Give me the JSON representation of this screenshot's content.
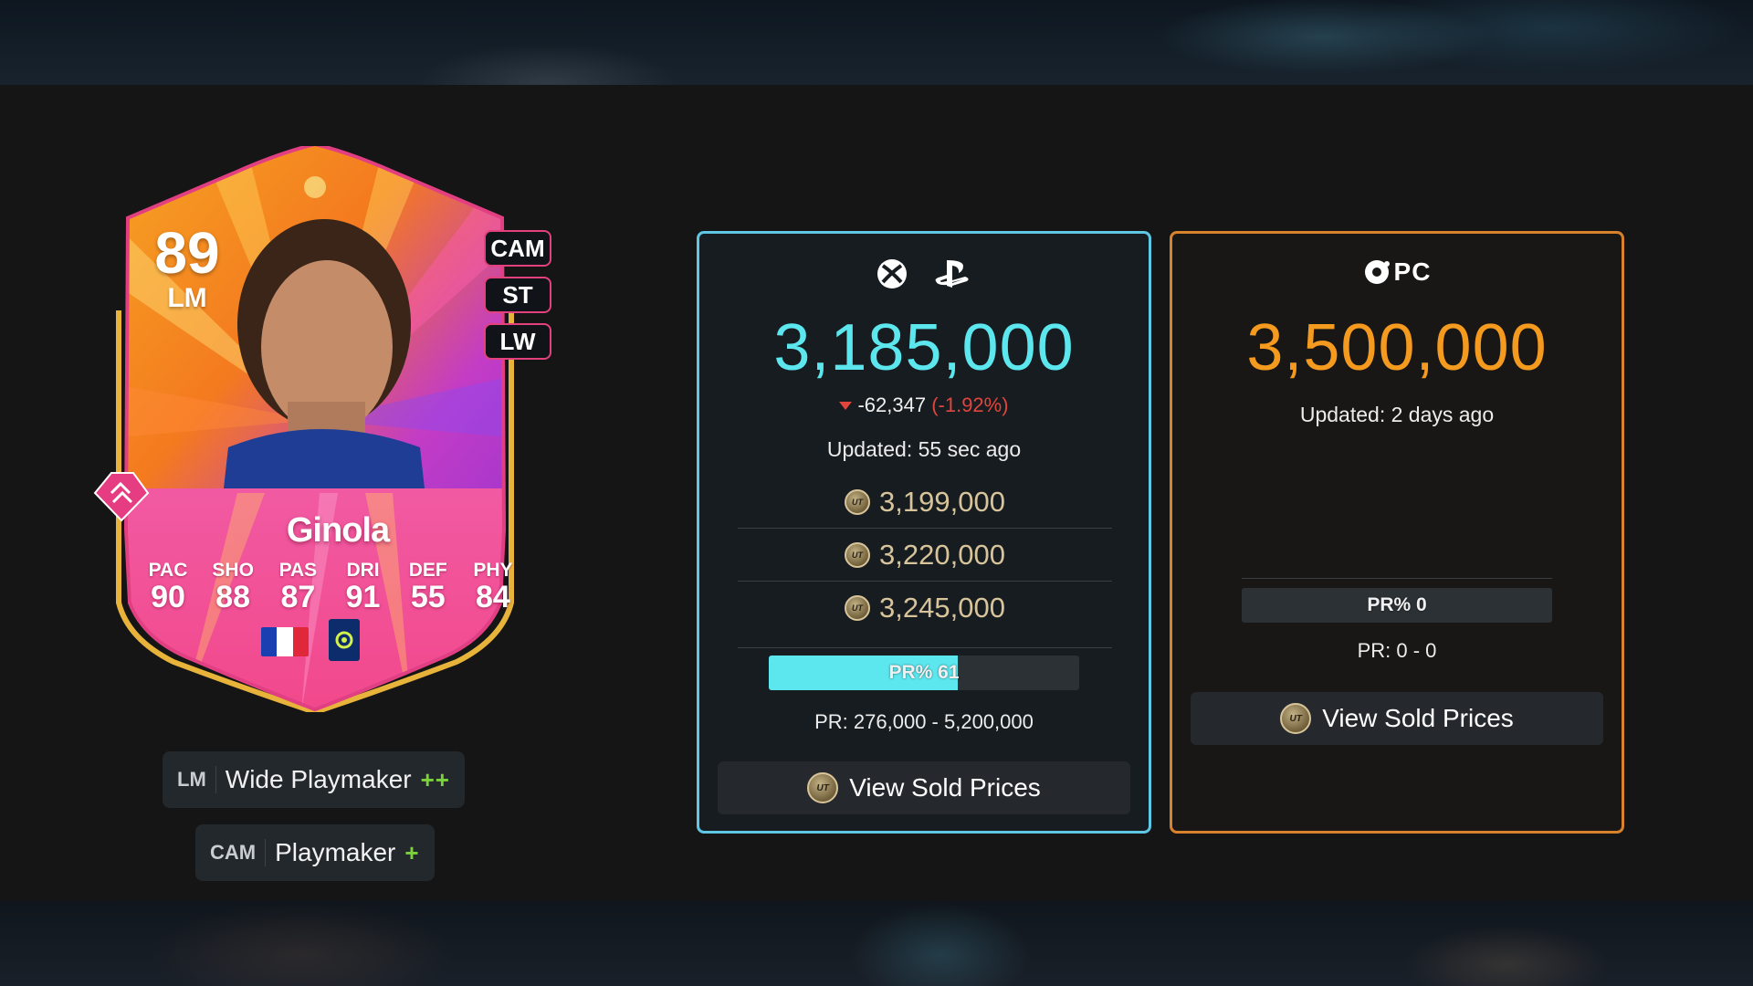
{
  "player": {
    "rating": "89",
    "position": "LM",
    "name": "Ginola",
    "alt_positions": [
      "CAM",
      "ST",
      "LW"
    ],
    "stats": [
      {
        "label": "PAC",
        "value": "90"
      },
      {
        "label": "SHO",
        "value": "88"
      },
      {
        "label": "PAS",
        "value": "87"
      },
      {
        "label": "DRI",
        "value": "91"
      },
      {
        "label": "DEF",
        "value": "55"
      },
      {
        "label": "PHY",
        "value": "84"
      }
    ],
    "nation_flag_colors": [
      "#1a3fb0",
      "#ffffff",
      "#e0283a"
    ]
  },
  "playstyles": [
    {
      "position": "LM",
      "role": "Wide Playmaker",
      "plus": "++"
    },
    {
      "position": "CAM",
      "role": "Playmaker",
      "plus": "+"
    }
  ],
  "console": {
    "platform_icons": [
      "xbox-icon",
      "playstation-icon"
    ],
    "price": "3,185,000",
    "change": "-62,347",
    "change_pct": "(-1.92%)",
    "updated": "Updated: 55 sec ago",
    "lowest_prices": [
      "3,199,000",
      "3,220,000",
      "3,245,000"
    ],
    "pr_label": "PR% 61",
    "pr_percent": 61,
    "pr_range": "PR: 276,000 - 5,200,000",
    "sold_button": "View Sold Prices",
    "accent": "#5ce6ee"
  },
  "pc": {
    "platform_label": "PC",
    "price": "3,500,000",
    "updated": "Updated: 2 days ago",
    "pr_label": "PR% 0",
    "pr_percent": 0,
    "pr_range": "PR: 0 - 0",
    "sold_button": "View Sold Prices",
    "accent": "#f49a1e"
  },
  "coin_icon_text": "UT"
}
